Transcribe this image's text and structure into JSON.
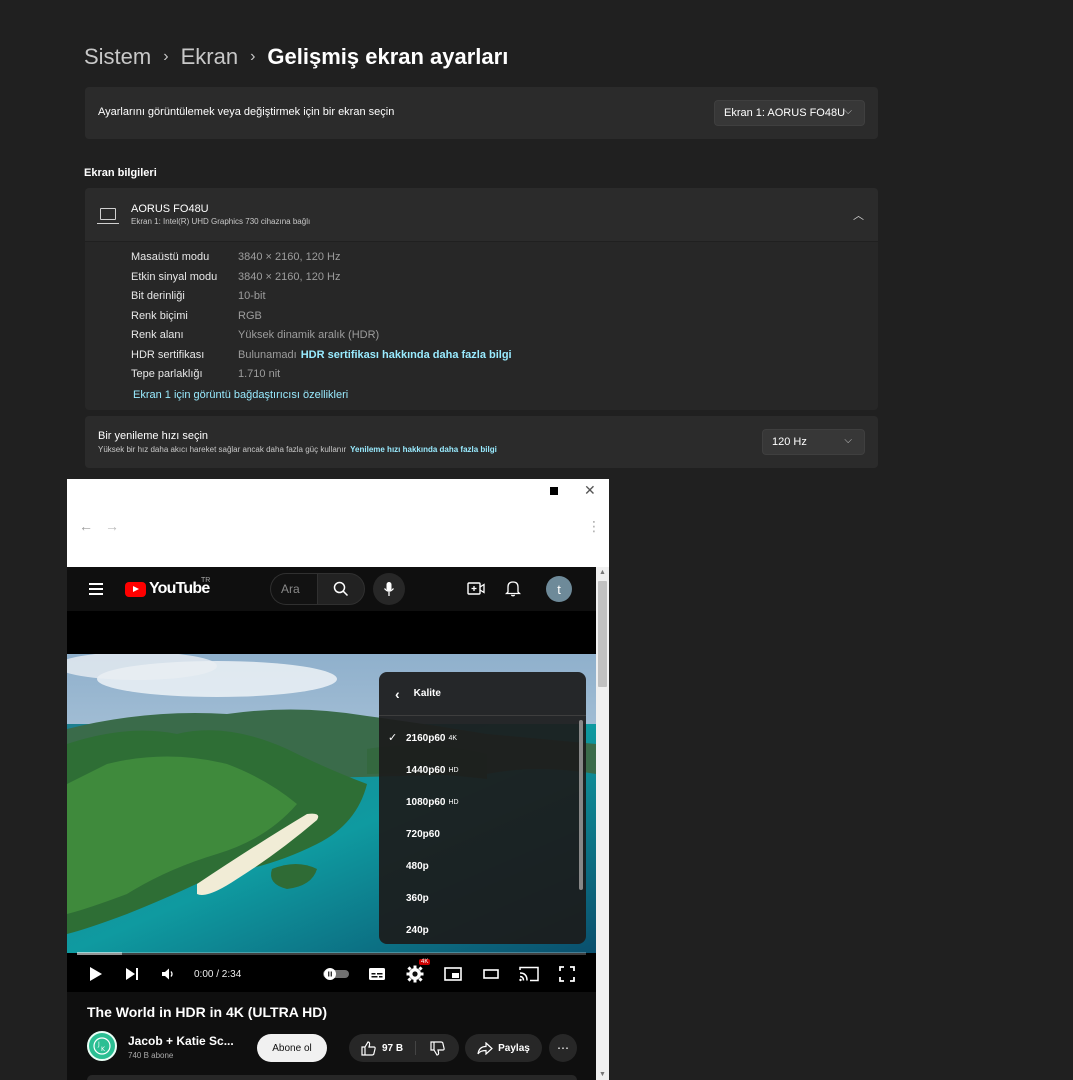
{
  "breadcrumb": {
    "items": [
      "Sistem",
      "Ekran"
    ],
    "current": "Gelişmiş ekran ayarları",
    "separator": "›"
  },
  "display_select": {
    "label": "Ayarlarını görüntülemek veya değiştirmek için bir ekran seçin",
    "value": "Ekran 1: AORUS FO48U"
  },
  "display_info": {
    "section_title": "Ekran bilgileri",
    "name": "AORUS FO48U",
    "subtitle": "Ekran 1: Intel(R) UHD Graphics 730 cihazına bağlı",
    "rows": [
      {
        "label": "Masaüstü modu",
        "value": "3840 × 2160, 120 Hz"
      },
      {
        "label": "Etkin sinyal modu",
        "value": "3840 × 2160, 120 Hz"
      },
      {
        "label": "Bit derinliği",
        "value": "10-bit"
      },
      {
        "label": "Renk biçimi",
        "value": "RGB"
      },
      {
        "label": "Renk alanı",
        "value": "Yüksek dinamik aralık (HDR)"
      },
      {
        "label": "HDR sertifikası",
        "value": "Bulunamadı",
        "link": "HDR sertifikası hakkında daha fazla bilgi"
      },
      {
        "label": "Tepe parlaklığı",
        "value": "1.710 nit"
      }
    ],
    "adapter_link": "Ekran 1 için görüntü bağdaştırıcısı özellikleri"
  },
  "refresh": {
    "title": "Bir yenileme hızı seçin",
    "subtitle": "Yüksek bir hız daha akıcı hareket sağlar ancak daha fazla güç kullanır",
    "link": "Yenileme hızı hakkında daha fazla bilgi",
    "value": "120 Hz"
  },
  "youtube": {
    "logo_text": "YouTube",
    "country": "TR",
    "search_placeholder": "Ara",
    "avatar_letter": "t",
    "player": {
      "time": "0:00 / 2:34",
      "settings_badge": "4K",
      "quality_menu": {
        "title": "Kalite",
        "items": [
          {
            "label": "2160p60",
            "badge": "4K",
            "selected": true
          },
          {
            "label": "1440p60",
            "badge": "HD",
            "selected": false
          },
          {
            "label": "1080p60",
            "badge": "HD",
            "selected": false
          },
          {
            "label": "720p60",
            "badge": "",
            "selected": false
          },
          {
            "label": "480p",
            "badge": "",
            "selected": false
          },
          {
            "label": "360p",
            "badge": "",
            "selected": false
          },
          {
            "label": "240p",
            "badge": "",
            "selected": false
          }
        ]
      }
    },
    "video_title": "The World in HDR in 4K (ULTRA HD)",
    "channel": {
      "name": "Jacob + Katie Sc...",
      "subscribers": "740 B abone"
    },
    "subscribe_label": "Abone ol",
    "likes": "97 B",
    "share_label": "Paylaş",
    "more_label": "⋯"
  },
  "colors": {
    "background": "#202020",
    "card": "#2b2b2b",
    "link": "#99ebff",
    "youtube_red": "#ff0000"
  }
}
